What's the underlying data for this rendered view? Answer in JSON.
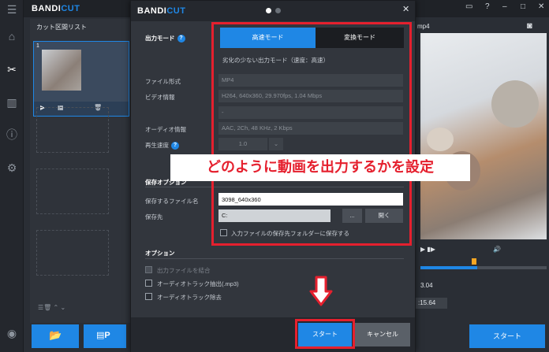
{
  "app": {
    "brand_a": "BANDI",
    "brand_b": "CUT",
    "window_buttons": [
      "📁",
      "?",
      "⎯",
      "☐",
      "✕"
    ]
  },
  "rail": {
    "icons": [
      "menu-icon",
      "home-icon",
      "cut-icon",
      "join-icon",
      "info-icon",
      "settings-icon",
      "record-icon"
    ]
  },
  "left": {
    "title": "カット区間リスト",
    "slot_number": "1"
  },
  "right": {
    "filename": "mp4",
    "time_a": "3.04",
    "time_b": ":15.64",
    "start_label": "スタート"
  },
  "dialog": {
    "brand_a": "BANDI",
    "brand_b": "CUT",
    "output_mode_label": "出力モード",
    "mode_fast": "高速モード",
    "mode_convert": "変換モード",
    "mode_desc": "劣化の少ない出力モード（速度：高速）",
    "format_label": "ファイル形式",
    "format_value": "MP4",
    "video_label": "ビデオ情報",
    "video_value": "H264, 640x360, 29.970fps, 1.04 Mbps",
    "video_extra": "-",
    "audio_label": "オーディオ情報",
    "audio_value": "AAC, 2Ch, 48 KHz, 2 Kbps",
    "speed_label": "再生速度",
    "speed_value": "1.0",
    "save_options": "保存オプション",
    "save_filename_label": "保存するファイル名",
    "save_filename_value": "3098_640x360",
    "save_dest_label": "保存先",
    "save_dest_value": "C:",
    "browse": "...",
    "open": "開く",
    "save_to_input_folder": "入力ファイルの保存先フォルダーに保存する",
    "options_title": "オプション",
    "opt_merge": "出力ファイルを結合",
    "opt_extract_audio": "オーディオトラック抽出(.mp3)",
    "opt_remove_audio": "オーディオトラック除去",
    "start": "スタート",
    "cancel": "キャンセル"
  },
  "annotation": {
    "callout": "どのように動画を出力するかを設定"
  },
  "colors": {
    "accent": "#1f87e5",
    "annotation_red": "#e5202e"
  }
}
